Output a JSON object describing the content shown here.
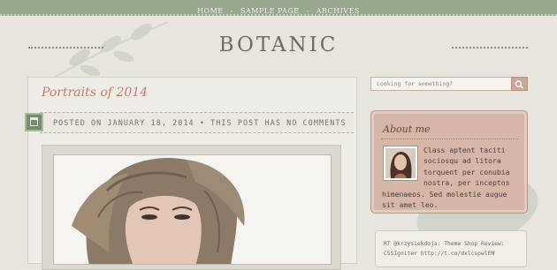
{
  "nav": {
    "items": [
      "HOME",
      "SAMPLE PAGE",
      "ARCHIVES"
    ],
    "separator": "-"
  },
  "site": {
    "title": "BOTANIC"
  },
  "post": {
    "title": "Portraits of 2014",
    "meta": "POSTED ON JANUARY 18, 2014 • THIS POST HAS NO COMMENTS"
  },
  "search": {
    "placeholder": "Looking for something?"
  },
  "about": {
    "title": "About me",
    "text": "Class aptent taciti sociosqu ad litora torquent per conubia nostra, per inceptos himenaeos. Sed molestie augue sit amet leo."
  },
  "twitter": {
    "text": "RT @krzysiekdoja: Theme Shop Review: CSSIgniter http://t.co/dxlcspwlEN"
  },
  "colors": {
    "nav_bar": "#97a88c",
    "accent_title": "#c0806b",
    "about_box": "#d7b6a7",
    "calendar_icon": "#748d6c"
  }
}
